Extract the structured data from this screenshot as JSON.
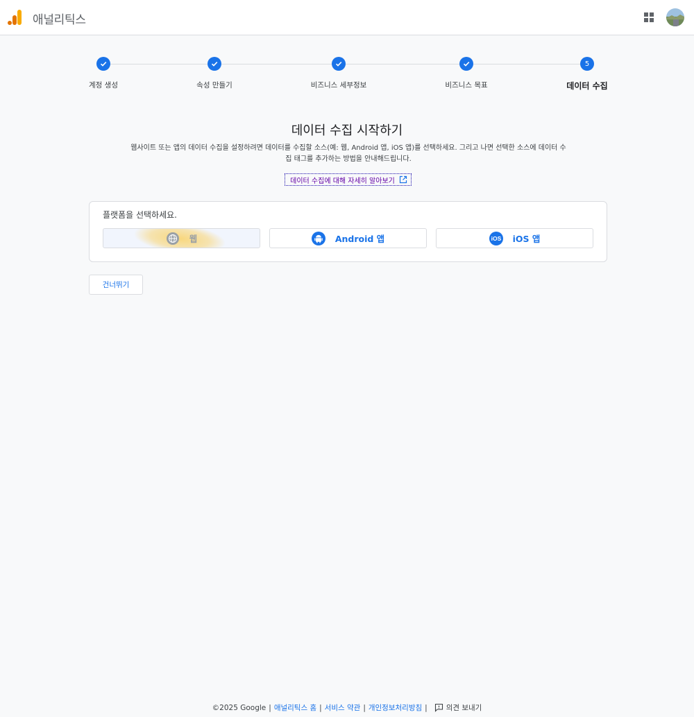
{
  "header": {
    "title": "애널리틱스",
    "apps_icon": "apps-grid-icon",
    "avatar_icon": "account-avatar"
  },
  "stepper": {
    "steps": [
      {
        "label": "계정 생성",
        "state": "done"
      },
      {
        "label": "속성 만들기",
        "state": "done"
      },
      {
        "label": "비즈니스 세부정보",
        "state": "done"
      },
      {
        "label": "비즈니스 목표",
        "state": "done"
      },
      {
        "label": "데이터 수집",
        "state": "active",
        "number": "5"
      }
    ]
  },
  "main": {
    "title": "데이터 수집 시작하기",
    "description": "웹사이트 또는 앱의 데이터 수집을 설정하려면 데이터를 수집할 소스(예: 웹, Android 앱, iOS 앱)를 선택하세요. 그리고 나면 선택한 소스에 데이터 수집 태그를 추가하는 방법을 안내해드립니다.",
    "learn_more": "데이터 수집에 대해 자세히 알아보기"
  },
  "platform": {
    "title": "플랫폼을 선택하세요.",
    "options": [
      {
        "label": "웹",
        "icon": "globe-icon",
        "selected": true
      },
      {
        "label": "Android 앱",
        "icon": "android-icon",
        "selected": false
      },
      {
        "label": "iOS 앱",
        "icon": "ios-icon",
        "selected": false
      }
    ]
  },
  "skip_label": "건너뛰기",
  "footer": {
    "copyright": "©2025 Google",
    "links": [
      "애널리틱스 홈",
      "서비스 약관",
      "개인정보처리방침"
    ],
    "feedback": "의견 보내기"
  },
  "colors": {
    "accent": "#1a73e8",
    "logo_orange": "#f9ab00",
    "logo_dark_orange": "#e37400"
  }
}
